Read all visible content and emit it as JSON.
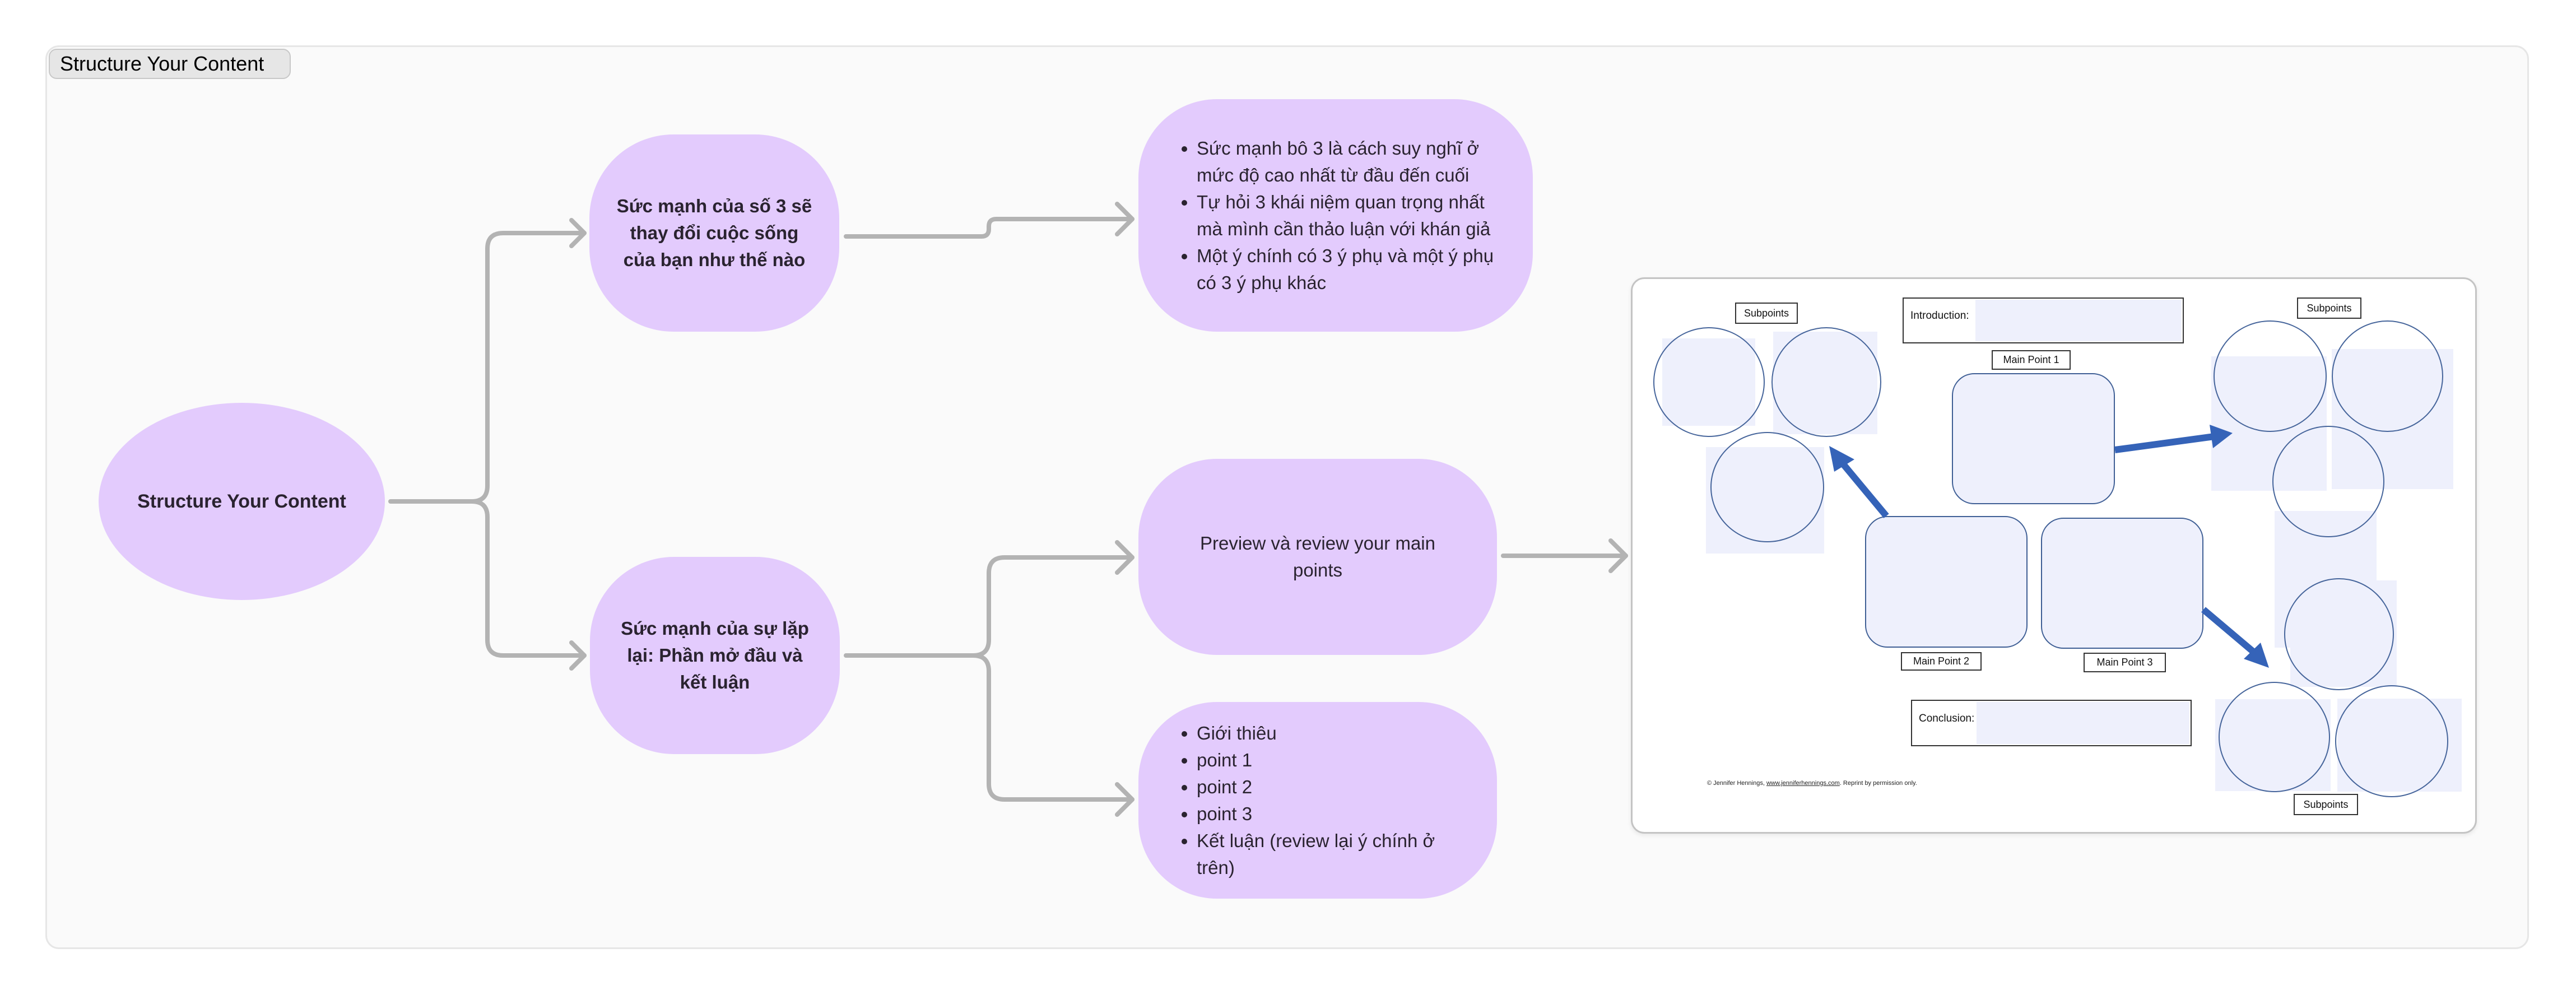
{
  "frame": {
    "title": "Structure Your Content"
  },
  "colors": {
    "node_fill": "#e3cbfd",
    "connector": "#b3b3b3",
    "frame_bg": "#fafafa",
    "template_blue": "#3563b8",
    "template_shade": "#eef0fc"
  },
  "mindmap": {
    "root": {
      "label": "Structure Your Content"
    },
    "topics": [
      {
        "label": "Sức mạnh của số 3 sẽ thay đổi cuộc sống của bạn như thế nào"
      },
      {
        "label": "Sức mạnh của sự lặp lại: Phần mở đầu và kết luận"
      }
    ],
    "details": [
      {
        "bullets": [
          "Sức mạnh bô 3 là cách suy nghĩ ở mức độ cao nhất từ đầu đến cuối",
          "Tự hỏi 3 khái niệm quan trọng nhất mà mình cần thảo luận với khán giả",
          "Một ý chính có 3 ý phụ và một ý phụ có 3 ý phụ khác"
        ]
      },
      {
        "label": "Preview và review your main points"
      },
      {
        "bullets": [
          "Giới thiêu",
          "point 1",
          "point 2",
          "point 3",
          "Kết luận (review lại ý chính ở trên)"
        ]
      }
    ]
  },
  "template_image": {
    "subpoints_label": "Subpoints",
    "introduction_label": "Introduction:",
    "conclusion_label": "Conclusion:",
    "main_points": [
      "Main Point 1",
      "Main Point 2",
      "Main Point 3"
    ],
    "copyright_prefix": "© Jennifer Hennings, ",
    "copyright_link": "www.jenniferhennings.com",
    "copyright_suffix": ". Reprint by permission only."
  }
}
